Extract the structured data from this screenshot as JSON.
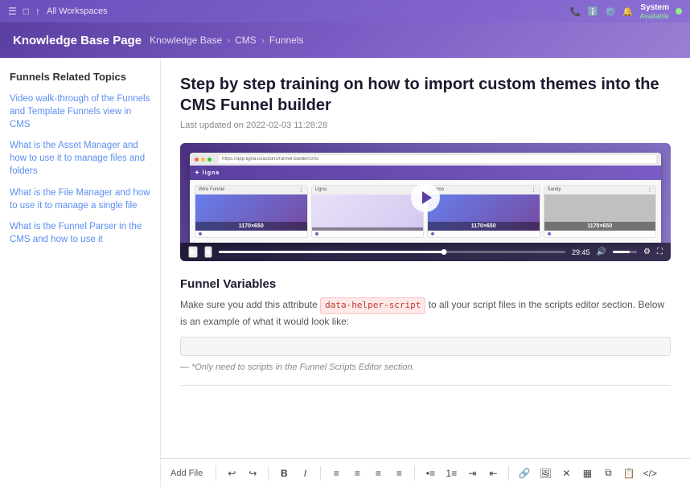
{
  "topNav": {
    "workspace": "All Workspaces",
    "icons": [
      "☰",
      "□",
      "↑"
    ],
    "userStatus": {
      "name": "System",
      "availability": "Available"
    },
    "rightIcons": [
      "📞",
      "ℹ️",
      "⚙️",
      "🔔"
    ]
  },
  "header": {
    "title": "Knowledge Base Page",
    "breadcrumb": [
      "Knowledge Base",
      "CMS",
      "Funnels"
    ]
  },
  "sidebar": {
    "title": "Funnels Related Topics",
    "links": [
      "Video walk-through of the Funnels and Template Funnels view in CMS",
      "What is the Asset Manager and how to use it to manage files and folders",
      "What is the File Manager and how to use it to manage a single file",
      "What is the Funnel Parser in the CMS and how to use it"
    ]
  },
  "article": {
    "title": "Step by step training on how to import custom themes into the CMS Funnel builder",
    "meta": "Last updated on 2022-02-03 11:28:28",
    "videoTime": "29:45",
    "progressPercent": 65,
    "volumePercent": 70,
    "browserUrl": "https://app.ligna.io/actions/funnel-builder/cms",
    "appLogo": "✦ ligna",
    "funnelCards": [
      {
        "title": "Wire Funnel",
        "type": "image",
        "label": "1170×650"
      },
      {
        "title": "Ligna",
        "type": "image",
        "label": ""
      },
      {
        "title": "Demo",
        "type": "image",
        "label": "1170×650"
      },
      {
        "title": "Sandy",
        "type": "gray",
        "label": "1170×650"
      }
    ]
  },
  "funnelVariables": {
    "title": "Funnel Variables",
    "description": "Make sure you add this attribute",
    "codeBadge": "data-helper-script",
    "descriptionEnd": "to all your script files in the scripts editor section. Below is an example of what it would look like:",
    "codeBlock": "",
    "note": "— *Only need to scripts in the Funnel Scripts Editor section."
  },
  "editorToolbar": {
    "addFileLabel": "Add File",
    "buttons": [
      "↩",
      "↪",
      "B",
      "I",
      "≡",
      "≡",
      "≡",
      "≡",
      "≡",
      "≡",
      "≡",
      "≡",
      "🔗",
      "🔗",
      "×",
      "□",
      "□",
      "□",
      "</>"
    ]
  }
}
